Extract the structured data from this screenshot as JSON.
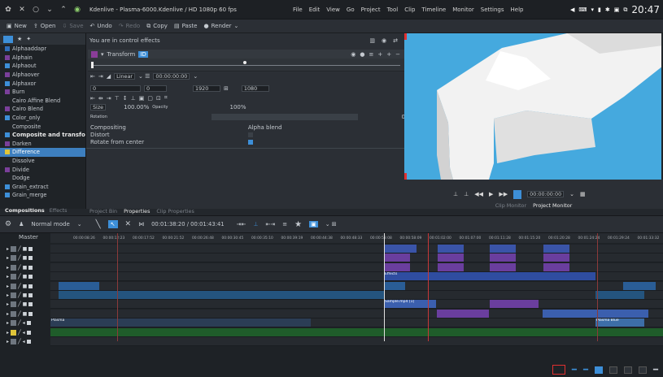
{
  "window": {
    "title": "Kdenlive - Plasma-6000.Kdenlive / HD 1080p 60 fps",
    "menu": [
      "File",
      "Edit",
      "View",
      "Go",
      "Project",
      "Tool",
      "Clip",
      "Timeline",
      "Monitor",
      "Settings",
      "Help"
    ],
    "clock": "20:47"
  },
  "toolbar": {
    "new": "New",
    "open": "Open",
    "save": "Save",
    "undo": "Undo",
    "redo": "Redo",
    "copy": "Copy",
    "paste": "Paste",
    "render": "Render"
  },
  "effects_list": {
    "items": [
      {
        "label": "Alphaaddapr",
        "color": "#2f6db8"
      },
      {
        "label": "Alphain",
        "color": "#7a3f9a"
      },
      {
        "label": "Alphaout",
        "color": "#3d8fd8"
      },
      {
        "label": "Alphaover",
        "color": "#7a3f9a"
      },
      {
        "label": "Alphaxor",
        "color": "#3d8fd8"
      },
      {
        "label": "Burn",
        "color": "#7a3f9a"
      },
      {
        "label": "Cairo Affine Blend",
        "color": "#1f2327"
      },
      {
        "label": "Cairo Blend",
        "color": "#7a3f9a"
      },
      {
        "label": "Color_only",
        "color": "#3d8fd8"
      },
      {
        "label": "Composite",
        "color": "#1f2327"
      },
      {
        "label": "Composite and transform",
        "color": "#3d8fd8"
      },
      {
        "label": "Darken",
        "color": "#7a3f9a"
      },
      {
        "label": "Difference",
        "color": "#e0c53a"
      },
      {
        "label": "Dissolve",
        "color": "#1f2327"
      },
      {
        "label": "Divide",
        "color": "#7a3f9a"
      },
      {
        "label": "Dodge",
        "color": "#1f2327"
      },
      {
        "label": "Grain_extract",
        "color": "#3d8fd8"
      },
      {
        "label": "Grain_merge",
        "color": "#3d8fd8"
      }
    ],
    "tabs": [
      "Compositions",
      "Effects"
    ]
  },
  "effect_panel": {
    "header": "You are in control effects",
    "effect_name": "Transform",
    "interp": "Linear",
    "timecode": "00:00:00:00",
    "x": "0",
    "y": "0",
    "w": "1920",
    "h": "1080",
    "size_label": "Size",
    "size_value": "100.00%",
    "opacity_label": "Opacity",
    "opacity_value": "100%",
    "rotation_label": "Rotation",
    "rotation_value": "0",
    "compositing_label": "Compositing",
    "compositing_value": "Alpha blend",
    "distort_label": "Distort",
    "rotate_label": "Rotate from center",
    "tabs": [
      "Project Bin",
      "Properties",
      "Clip Properties"
    ]
  },
  "monitor": {
    "timecode": "00:00:00:00",
    "tabs": [
      "Clip Monitor",
      "Project Monitor"
    ]
  },
  "timeline": {
    "mode": "Normal mode",
    "position": "00:01:38:20 / 00:01:43:41",
    "master": "Master",
    "ruler": [
      "00:00:08:26",
      "00:00:12:23",
      "00:00:17:52",
      "00:00:21:52",
      "00:00:26:48",
      "00:00:30:45",
      "00:00:35:10",
      "00:00:39:19",
      "00:00:44:38",
      "00:00:48:33",
      "00:00:53:08",
      "00:00:58:09",
      "00:01:02:00",
      "00:01:07:00",
      "00:01:11:28",
      "00:01:15:20",
      "00:01:20:28",
      "00:01:24:24",
      "00:01:29:24",
      "00:01:33:32"
    ],
    "tracks": [
      {
        "type": "V"
      },
      {
        "type": "V"
      },
      {
        "type": "V"
      },
      {
        "type": "V"
      },
      {
        "type": "V"
      },
      {
        "type": "V"
      },
      {
        "type": "V"
      },
      {
        "type": "V"
      },
      {
        "type": "A"
      },
      {
        "type": "A"
      },
      {
        "type": "A"
      }
    ]
  },
  "clip_labels": {
    "a1": "Sample.mp4 [1]",
    "a2": "Plasma Blue",
    "a3": "Plasma",
    "a4": "Effects"
  }
}
